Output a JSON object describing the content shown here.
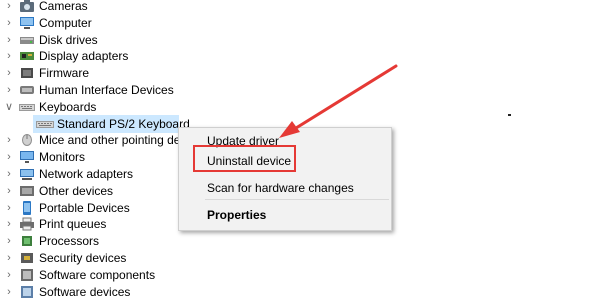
{
  "device_tree": [
    {
      "label": "Cameras",
      "icon": "camera-icon",
      "expanded": false,
      "level": 1
    },
    {
      "label": "Computer",
      "icon": "computer-icon",
      "expanded": false,
      "level": 1
    },
    {
      "label": "Disk drives",
      "icon": "disk-drive-icon",
      "expanded": false,
      "level": 1
    },
    {
      "label": "Display adapters",
      "icon": "display-adapter-icon",
      "expanded": false,
      "level": 1
    },
    {
      "label": "Firmware",
      "icon": "firmware-icon",
      "expanded": false,
      "level": 1
    },
    {
      "label": "Human Interface Devices",
      "icon": "hid-icon",
      "expanded": false,
      "level": 1
    },
    {
      "label": "Keyboards",
      "icon": "keyboard-icon",
      "expanded": true,
      "level": 1
    },
    {
      "label": "Standard PS/2 Keyboard",
      "icon": "keyboard-device-icon",
      "level": 2,
      "selected": true
    },
    {
      "label": "Mice and other pointing de",
      "icon": "mouse-icon",
      "expanded": false,
      "level": 1
    },
    {
      "label": "Monitors",
      "icon": "monitor-icon",
      "expanded": false,
      "level": 1
    },
    {
      "label": "Network adapters",
      "icon": "network-adapter-icon",
      "expanded": false,
      "level": 1
    },
    {
      "label": "Other devices",
      "icon": "other-devices-icon",
      "expanded": false,
      "level": 1
    },
    {
      "label": "Portable Devices",
      "icon": "portable-device-icon",
      "expanded": false,
      "level": 1
    },
    {
      "label": "Print queues",
      "icon": "printer-icon",
      "expanded": false,
      "level": 1
    },
    {
      "label": "Processors",
      "icon": "processor-icon",
      "expanded": false,
      "level": 1
    },
    {
      "label": "Security devices",
      "icon": "security-device-icon",
      "expanded": false,
      "level": 1
    },
    {
      "label": "Software components",
      "icon": "software-component-icon",
      "expanded": false,
      "level": 1
    },
    {
      "label": "Software devices",
      "icon": "software-device-icon",
      "expanded": false,
      "level": 1
    }
  ],
  "context_menu": {
    "update_driver": "Update driver",
    "uninstall_device": "Uninstall device",
    "scan_hardware": "Scan for hardware changes",
    "properties": "Properties"
  },
  "colors": {
    "selection": "#cce8ff",
    "annotation": "#e53935",
    "menu_bg": "#f2f2f2"
  }
}
